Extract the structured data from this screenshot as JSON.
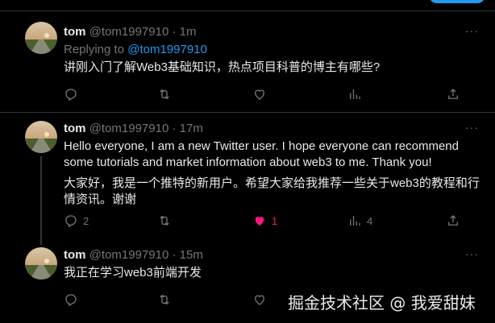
{
  "colors": {
    "background": "#000000",
    "text": "#e7e9ea",
    "muted": "#71767b",
    "link": "#1d9bf0",
    "like": "#f91880",
    "divider": "#2f3336"
  },
  "tweets": [
    {
      "name": "tom",
      "handle": "@tom1997910",
      "separator": "·",
      "time": "1m",
      "more": "···",
      "replying_prefix": "Replying to ",
      "replying_handle": "@tom1997910",
      "text": "讲刚入门了解Web3基础知识，热点项目科普的博主有哪些?",
      "actions": {
        "reply_icon": "reply-icon",
        "retweet_icon": "retweet-icon",
        "like_icon": "heart-icon",
        "views_icon": "views-icon",
        "share_icon": "share-icon"
      }
    },
    {
      "name": "tom",
      "handle": "@tom1997910",
      "separator": "·",
      "time": "17m",
      "more": "···",
      "text_en": "Hello everyone, I am a new Twitter user. I hope everyone can recommend some tutorials and market information about web3 to me. Thank you!",
      "text_zh": "大家好，我是一个推特的新用户。希望大家给我推荐一些关于web3的教程和行情资讯。谢谢",
      "replies": "2",
      "likes": "1",
      "views": "4"
    },
    {
      "name": "tom",
      "handle": "@tom1997910",
      "separator": "·",
      "time": "15m",
      "more": "···",
      "text": "我正在学习web3前端开发"
    }
  ],
  "watermark": "掘金技术社区 @ 我爱甜妹"
}
